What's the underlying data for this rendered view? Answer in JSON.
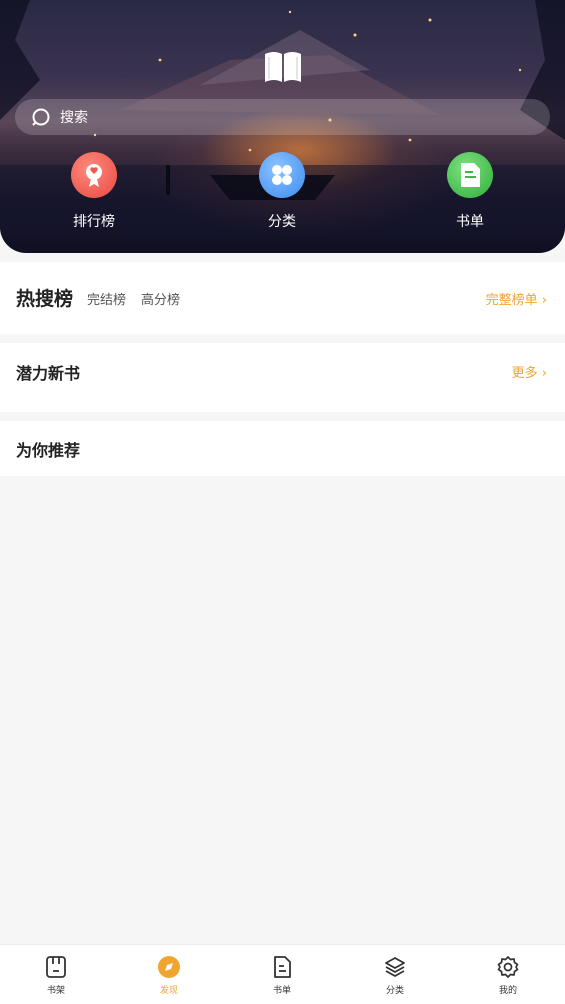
{
  "search": {
    "placeholder": "搜索"
  },
  "quick_links": [
    {
      "label": "排行榜",
      "color": "#f0574e"
    },
    {
      "label": "分类",
      "color": "#3c8af0"
    },
    {
      "label": "书单",
      "color": "#3cb84a"
    }
  ],
  "hot_search": {
    "title": "热搜榜",
    "tabs": [
      "完结榜",
      "高分榜"
    ],
    "more": "完整榜单"
  },
  "potential": {
    "title": "潜力新书",
    "more": "更多"
  },
  "recommend": {
    "title": "为你推荐"
  },
  "bottom_nav": [
    {
      "label": "书架",
      "icon": "bookshelf-icon"
    },
    {
      "label": "发现",
      "icon": "discover-icon",
      "active": true
    },
    {
      "label": "书单",
      "icon": "booklist-icon"
    },
    {
      "label": "分类",
      "icon": "layers-icon"
    },
    {
      "label": "我的",
      "icon": "gear-icon"
    }
  ],
  "colors": {
    "accent": "#f0a52e"
  }
}
